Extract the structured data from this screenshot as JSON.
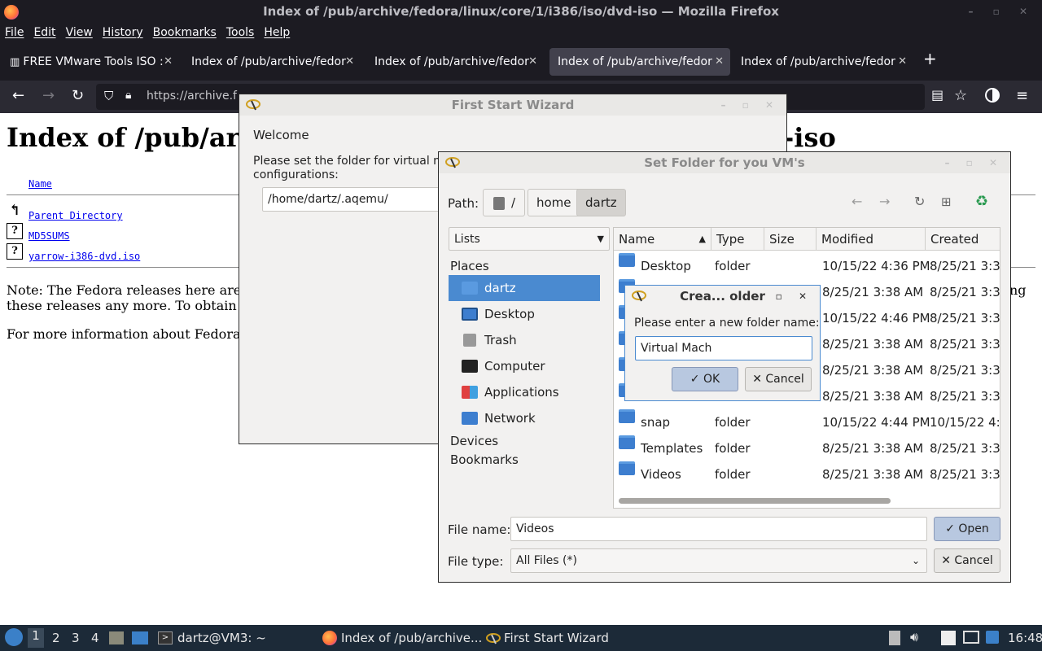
{
  "firefox": {
    "window_title": "Index of /pub/archive/fedora/linux/core/1/i386/iso/dvd-iso — Mozilla Firefox",
    "menu": [
      "File",
      "Edit",
      "View",
      "History",
      "Bookmarks",
      "Tools",
      "Help"
    ],
    "tabs": [
      {
        "label": "FREE VMware Tools ISO :"
      },
      {
        "label": "Index of /pub/archive/fedora"
      },
      {
        "label": "Index of /pub/archive/fedora"
      },
      {
        "label": "Index of /pub/archive/fedora"
      },
      {
        "label": "Index of /pub/archive/fedora"
      }
    ],
    "url": "https://archive.f"
  },
  "page": {
    "heading_left": "Index of /pub/ar",
    "heading_right": "-iso",
    "col_name": "Name",
    "parent": "Parent Directory",
    "files": [
      "MD5SUMS",
      "yarrow-i386-dvd.iso"
    ],
    "note1": "Note: The Fedora releases here are",
    "note1_end": "ng",
    "note2": "these releases any more. To obtain",
    "note3": "For more information about Fedora"
  },
  "wizard": {
    "title": "First Start Wizard",
    "welcome": "Welcome",
    "prompt1": "Please set the folder for virtual m",
    "prompt2": "configurations:",
    "folder": "/home/dartz/.aqemu/"
  },
  "chooser": {
    "title": "Set Folder for you VM's",
    "path_label": "Path:",
    "path_root": "/",
    "path_segments": [
      "home",
      "dartz"
    ],
    "lists": "Lists",
    "places_header": "Places",
    "places": [
      "dartz",
      "Desktop",
      "Trash",
      "Computer",
      "Applications",
      "Network"
    ],
    "devices_header": "Devices",
    "bookmarks_header": "Bookmarks",
    "columns": [
      "Name",
      "Type",
      "Size",
      "Modified",
      "Created"
    ],
    "rows": [
      {
        "name": "Desktop",
        "type": "folder",
        "modified": "10/15/22 4:36 PM",
        "created": "8/25/21 3:38"
      },
      {
        "name": "",
        "type": "",
        "modified": "8/25/21 3:38 AM",
        "created": "8/25/21 3:38"
      },
      {
        "name": "",
        "type": "",
        "modified": "10/15/22 4:46 PM",
        "created": "8/25/21 3:38"
      },
      {
        "name": "",
        "type": "",
        "modified": "8/25/21 3:38 AM",
        "created": "8/25/21 3:38"
      },
      {
        "name": "",
        "type": "",
        "modified": "8/25/21 3:38 AM",
        "created": "8/25/21 3:38"
      },
      {
        "name": "",
        "type": "",
        "modified": "8/25/21 3:38 AM",
        "created": "8/25/21 3:38"
      },
      {
        "name": "snap",
        "type": "folder",
        "modified": "10/15/22 4:44 PM",
        "created": "10/15/22 4:4"
      },
      {
        "name": "Templates",
        "type": "folder",
        "modified": "8/25/21 3:38 AM",
        "created": "8/25/21 3:38"
      },
      {
        "name": "Videos",
        "type": "folder",
        "modified": "8/25/21 3:38 AM",
        "created": "8/25/21 3:38"
      }
    ],
    "filename_label": "File name:",
    "filename": "Videos",
    "filetype_label": "File type:",
    "filetype": "All Files (*)",
    "open": "Open",
    "cancel": "Cancel"
  },
  "create": {
    "title": "Crea... older",
    "prompt": "Please enter a new folder name:",
    "value": "Virtual Mach",
    "ok": "OK",
    "cancel": "Cancel"
  },
  "taskbar": {
    "workspaces": [
      "1",
      "2",
      "3",
      "4"
    ],
    "terminal": "dartz@VM3: ~",
    "firefox": "Index of /pub/archive...",
    "wizard": "First Start Wizard",
    "clock": "16:48"
  }
}
